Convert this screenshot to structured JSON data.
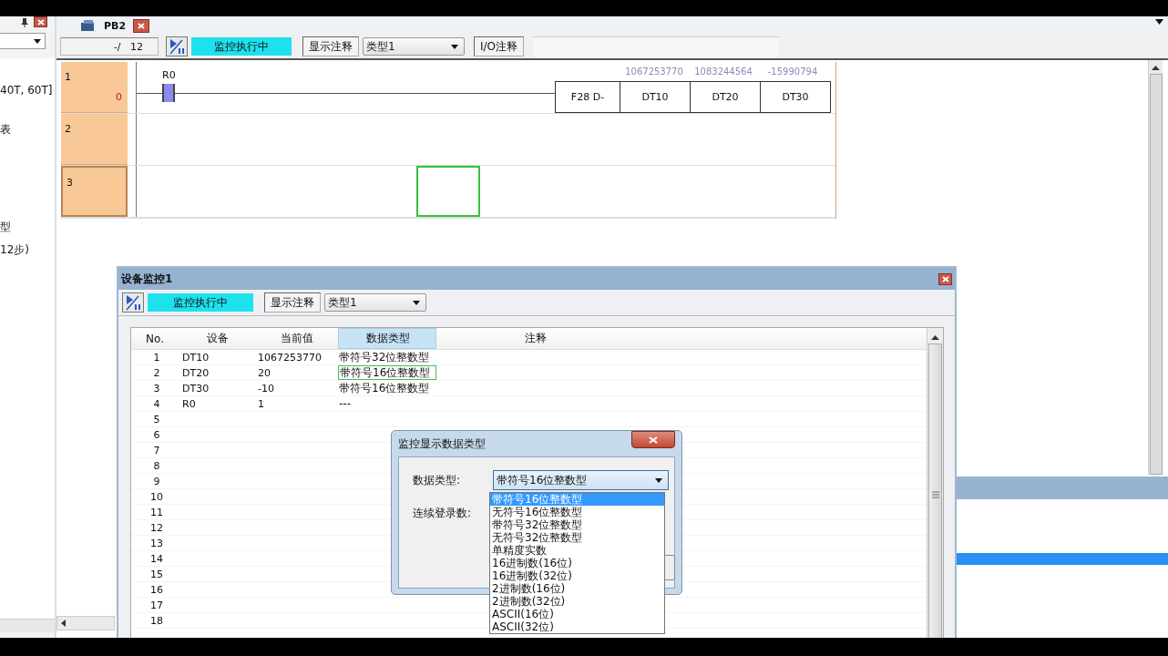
{
  "sidebar": {
    "texts": [
      "40T, 60T]",
      "表",
      "型",
      "12步)"
    ]
  },
  "editor": {
    "tab": {
      "label": "PB2"
    },
    "toolbar": {
      "step": "-/   12",
      "monitor_status": "监控执行中",
      "comment_button": "显示注释",
      "type_select": "类型1",
      "io_button": "I/O注释"
    },
    "rungs": [
      {
        "number": "1",
        "address": "0",
        "selected": false,
        "contact": "R0",
        "instruction": "F28 D-",
        "operands": [
          {
            "name": "DT10",
            "value": "1067253770"
          },
          {
            "name": "DT20",
            "value": "1083244564"
          },
          {
            "name": "DT30",
            "value": "-15990794"
          }
        ]
      },
      {
        "number": "2",
        "selected": false
      },
      {
        "number": "3",
        "selected": true
      }
    ]
  },
  "monitor_window": {
    "title": "设备监控1",
    "toolbar": {
      "monitor_status": "监控执行中",
      "comment_button": "显示注释",
      "type_select": "类型1"
    },
    "columns": [
      "No.",
      "设备",
      "当前值",
      "数据类型",
      "注释"
    ],
    "rows": [
      {
        "no": "1",
        "device": "DT10",
        "value": "1067253770",
        "data_type": "带符号32位整数型",
        "selected": false
      },
      {
        "no": "2",
        "device": "DT20",
        "value": "20",
        "data_type": "带符号16位整数型",
        "selected": true
      },
      {
        "no": "3",
        "device": "DT30",
        "value": "-10",
        "data_type": "带符号16位整数型",
        "selected": false
      },
      {
        "no": "4",
        "device": "R0",
        "value": "1",
        "data_type": "---",
        "selected": false
      },
      {
        "no": "5"
      },
      {
        "no": "6"
      },
      {
        "no": "7"
      },
      {
        "no": "8"
      },
      {
        "no": "9"
      },
      {
        "no": "10"
      },
      {
        "no": "11"
      },
      {
        "no": "12"
      },
      {
        "no": "13"
      },
      {
        "no": "14"
      },
      {
        "no": "15"
      },
      {
        "no": "16"
      },
      {
        "no": "17"
      },
      {
        "no": "18"
      }
    ]
  },
  "dialog": {
    "title": "监控显示数据类型",
    "fields": [
      {
        "label": "数据类型:",
        "value": "带符号16位整数型"
      },
      {
        "label": "连续登录数:"
      }
    ],
    "options": [
      {
        "label": "带符号16位整数型",
        "selected": true
      },
      {
        "label": "无符号16位整数型",
        "selected": false
      },
      {
        "label": "带符号32位整数型",
        "selected": false
      },
      {
        "label": "无符号32位整数型",
        "selected": false
      },
      {
        "label": "单精度实数",
        "selected": false
      },
      {
        "label": "16进制数(16位)",
        "selected": false
      },
      {
        "label": "16进制数(32位)",
        "selected": false
      },
      {
        "label": "2进制数(16位)",
        "selected": false
      },
      {
        "label": "2进制数(32位)",
        "selected": false
      },
      {
        "label": "ASCII(16位)",
        "selected": false
      },
      {
        "label": "ASCII(32位)",
        "selected": false
      }
    ]
  }
}
